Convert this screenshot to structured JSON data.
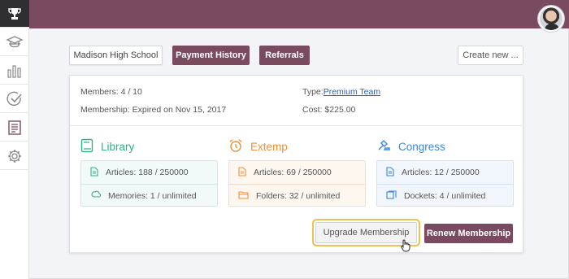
{
  "sidebar": {
    "items": [
      {
        "icon": "trophy-icon",
        "active": true
      },
      {
        "icon": "graduation-cap-icon"
      },
      {
        "icon": "bar-chart-icon"
      },
      {
        "icon": "checkmark-circle-icon"
      },
      {
        "icon": "document-list-icon"
      },
      {
        "icon": "gear-icon"
      }
    ]
  },
  "header": {
    "avatar_icon": "user-avatar",
    "brand_color": "#7a4a61"
  },
  "toolbar": {
    "school_label": "Madison High School",
    "payment_history_label": "Payment History",
    "referrals_label": "Referrals",
    "create_new_label": "Create new ..."
  },
  "membership": {
    "members_text": "Members: 4 / 10",
    "status_text": "Membership: Expired on Nov 15, 2017",
    "type_label": "Type:",
    "type_value": "Premium Team",
    "cost_text": "Cost: $225.00"
  },
  "sections": {
    "library": {
      "title": "Library",
      "color": "#2bb389",
      "rows": [
        {
          "icon": "document-icon",
          "text": "Articles:  188 / 250000"
        },
        {
          "icon": "brain-icon",
          "text": "Memories:  1 / unlimited"
        }
      ]
    },
    "extemp": {
      "title": "Extemp",
      "color": "#f0903a",
      "rows": [
        {
          "icon": "document-icon",
          "text": "Articles:  69 / 250000"
        },
        {
          "icon": "folders-icon",
          "text": "Folders:  32 / unlimited"
        }
      ]
    },
    "congress": {
      "title": "Congress",
      "color": "#3a86e0",
      "rows": [
        {
          "icon": "document-icon",
          "text": "Articles:  12 / 250000"
        },
        {
          "icon": "dockets-icon",
          "text": "Dockets:  4 / unlimited"
        }
      ]
    }
  },
  "actions": {
    "upgrade_label": "Upgrade Membership",
    "renew_label": "Renew Membership"
  }
}
